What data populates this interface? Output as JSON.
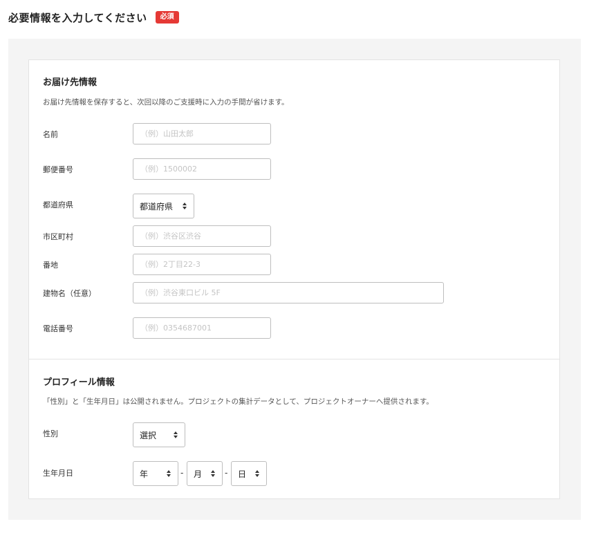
{
  "header": {
    "title": "必要情報を入力してください",
    "badge": "必須",
    "badge_color": "#e53935"
  },
  "shipping": {
    "title": "お届け先情報",
    "description": "お届け先情報を保存すると、次回以降のご支援時に入力の手間が省けます。",
    "fields": {
      "name": {
        "label": "名前",
        "placeholder": "（例）山田太郎",
        "value": ""
      },
      "postal": {
        "label": "郵便番号",
        "placeholder": "（例）1500002",
        "value": ""
      },
      "prefecture": {
        "label": "都道府県",
        "selected": "都道府県"
      },
      "city": {
        "label": "市区町村",
        "placeholder": "（例）渋谷区渋谷",
        "value": ""
      },
      "address": {
        "label": "番地",
        "placeholder": "（例）2丁目22-3",
        "value": ""
      },
      "building": {
        "label": "建物名（任意）",
        "placeholder": "（例）渋谷東口ビル 5F",
        "value": ""
      },
      "phone": {
        "label": "電話番号",
        "placeholder": "（例）0354687001",
        "value": ""
      }
    }
  },
  "profile": {
    "title": "プロフィール情報",
    "description": "「性別」と「生年月日」は公開されません。プロジェクトの集計データとして、プロジェクトオーナーへ提供されます。",
    "fields": {
      "gender": {
        "label": "性別",
        "selected": "選択"
      },
      "birthdate": {
        "label": "生年月日",
        "year": "年",
        "month": "月",
        "day": "日",
        "separator": "-"
      }
    }
  },
  "icons": {
    "select_arrows": "select-arrows-icon"
  }
}
